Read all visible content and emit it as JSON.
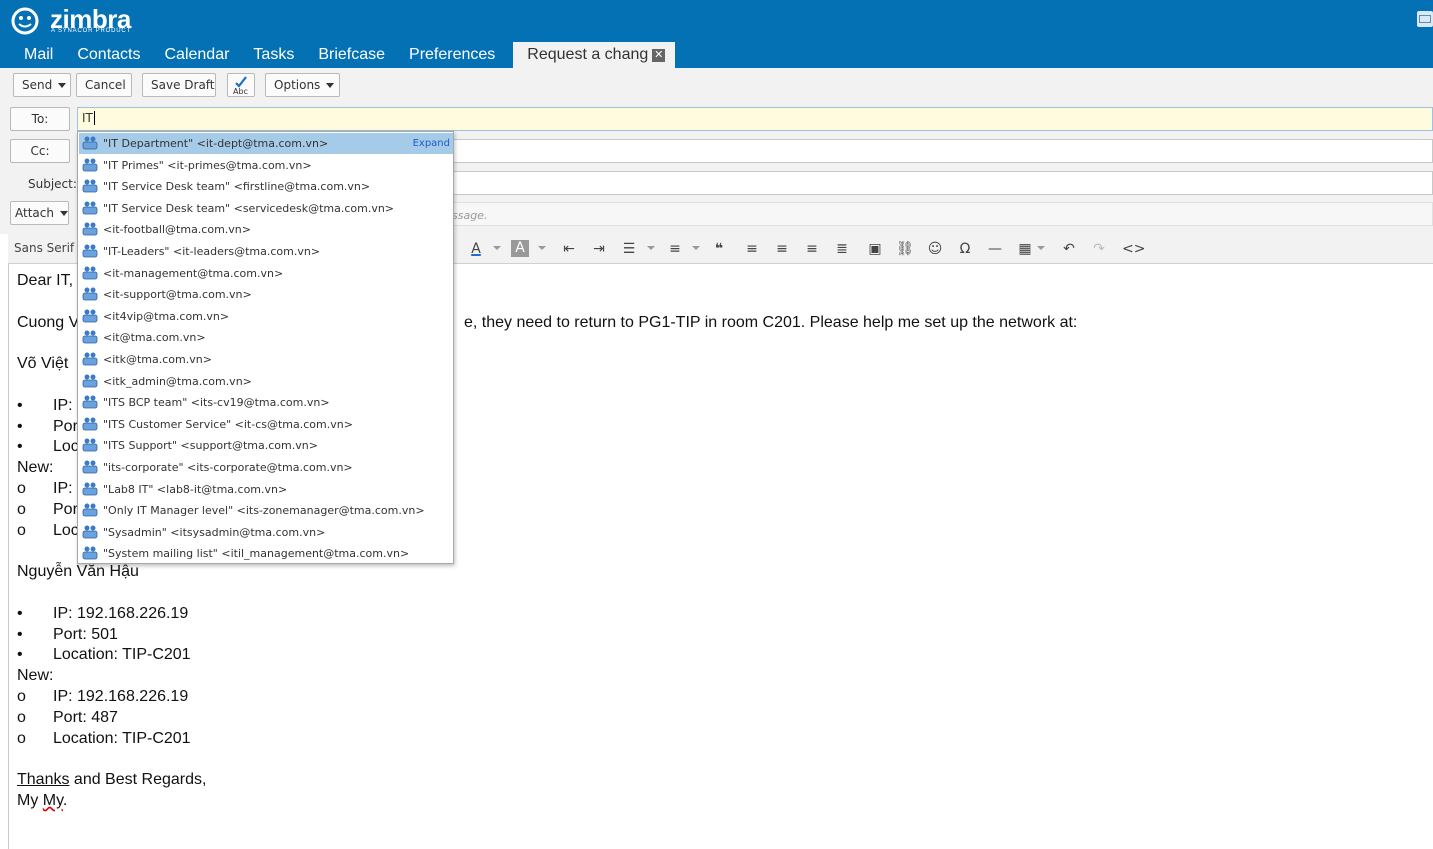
{
  "app": {
    "logo_text": "zimbra",
    "logo_sub": "A SYNACOR PRODUCT",
    "tabs": [
      {
        "label": "Mail"
      },
      {
        "label": "Contacts"
      },
      {
        "label": "Calendar"
      },
      {
        "label": "Tasks"
      },
      {
        "label": "Briefcase"
      },
      {
        "label": "Preferences"
      }
    ],
    "active_tab": {
      "label": "Request a chang",
      "close_icon": "close-icon"
    }
  },
  "toolbar": {
    "send": "Send",
    "cancel": "Cancel",
    "save_draft": "Save Draft",
    "spell_check_icon_label": "Abc",
    "options": "Options"
  },
  "compose": {
    "to_label": "To:",
    "cc_label": "Cc:",
    "subject_label": "Subject:",
    "attach_label": "Attach",
    "to_value": "IT",
    "body_hint": "ssage."
  },
  "format": {
    "font_name": "Sans Serif"
  },
  "autocomplete": {
    "expand_label": "Expand",
    "items": [
      "\"IT Department\" <it-dept@tma.com.vn>",
      "\"IT Primes\" <it-primes@tma.com.vn>",
      "\"IT Service Desk team\" <firstline@tma.com.vn>",
      "\"IT Service Desk team\" <servicedesk@tma.com.vn>",
      "<it-football@tma.com.vn>",
      "\"IT-Leaders\" <it-leaders@tma.com.vn>",
      "<it-management@tma.com.vn>",
      "<it-support@tma.com.vn>",
      "<it4vip@tma.com.vn>",
      "<it@tma.com.vn>",
      "<itk@tma.com.vn>",
      "<itk_admin@tma.com.vn>",
      "\"ITS BCP team\" <its-cv19@tma.com.vn>",
      "\"ITS Customer Service\" <it-cs@tma.com.vn>",
      "\"ITS Support\" <support@tma.com.vn>",
      "\"its-corporate\" <its-corporate@tma.com.vn>",
      "\"Lab8 IT\" <lab8-it@tma.com.vn>",
      "\"Only IT Manager level\" <its-zonemanager@tma.com.vn>",
      "\"Sysadmin\" <itsysadmin@tma.com.vn>",
      "\"System mailing list\" <itil_management@tma.com.vn>"
    ]
  },
  "body": {
    "greeting": "Dear IT,",
    "para1_start": "Cuong V",
    "para1_end": "e, they need to return to PG1-TIP in room C201. Please help me set up the network at:",
    "person1_start": "Võ Việt",
    "p1_ip": "IP:",
    "p1_port": "Por",
    "p1_loc": "Loc",
    "p1_new": "New:",
    "p1_new_ip": "IP:",
    "p1_new_port": "Por",
    "p1_new_loc": "Loc",
    "bullet": "•",
    "sub_bullet": "o",
    "person2": "Nguyễn Văn Hậu",
    "p2_ip": "IP: 192.168.226.19",
    "p2_port": "Port: 501",
    "p2_loc": "Location: TIP-C201",
    "p2_new": "New:",
    "p2_new_ip": "IP: 192.168.226.19",
    "p2_new_port": "Port: 487",
    "p2_new_loc": "Location: TIP-C201",
    "thanks_word": "Thanks",
    "thanks_rest": " and Best Regards,",
    "sign_first": "My ",
    "sign_second": "My",
    "sign_dot": "."
  }
}
